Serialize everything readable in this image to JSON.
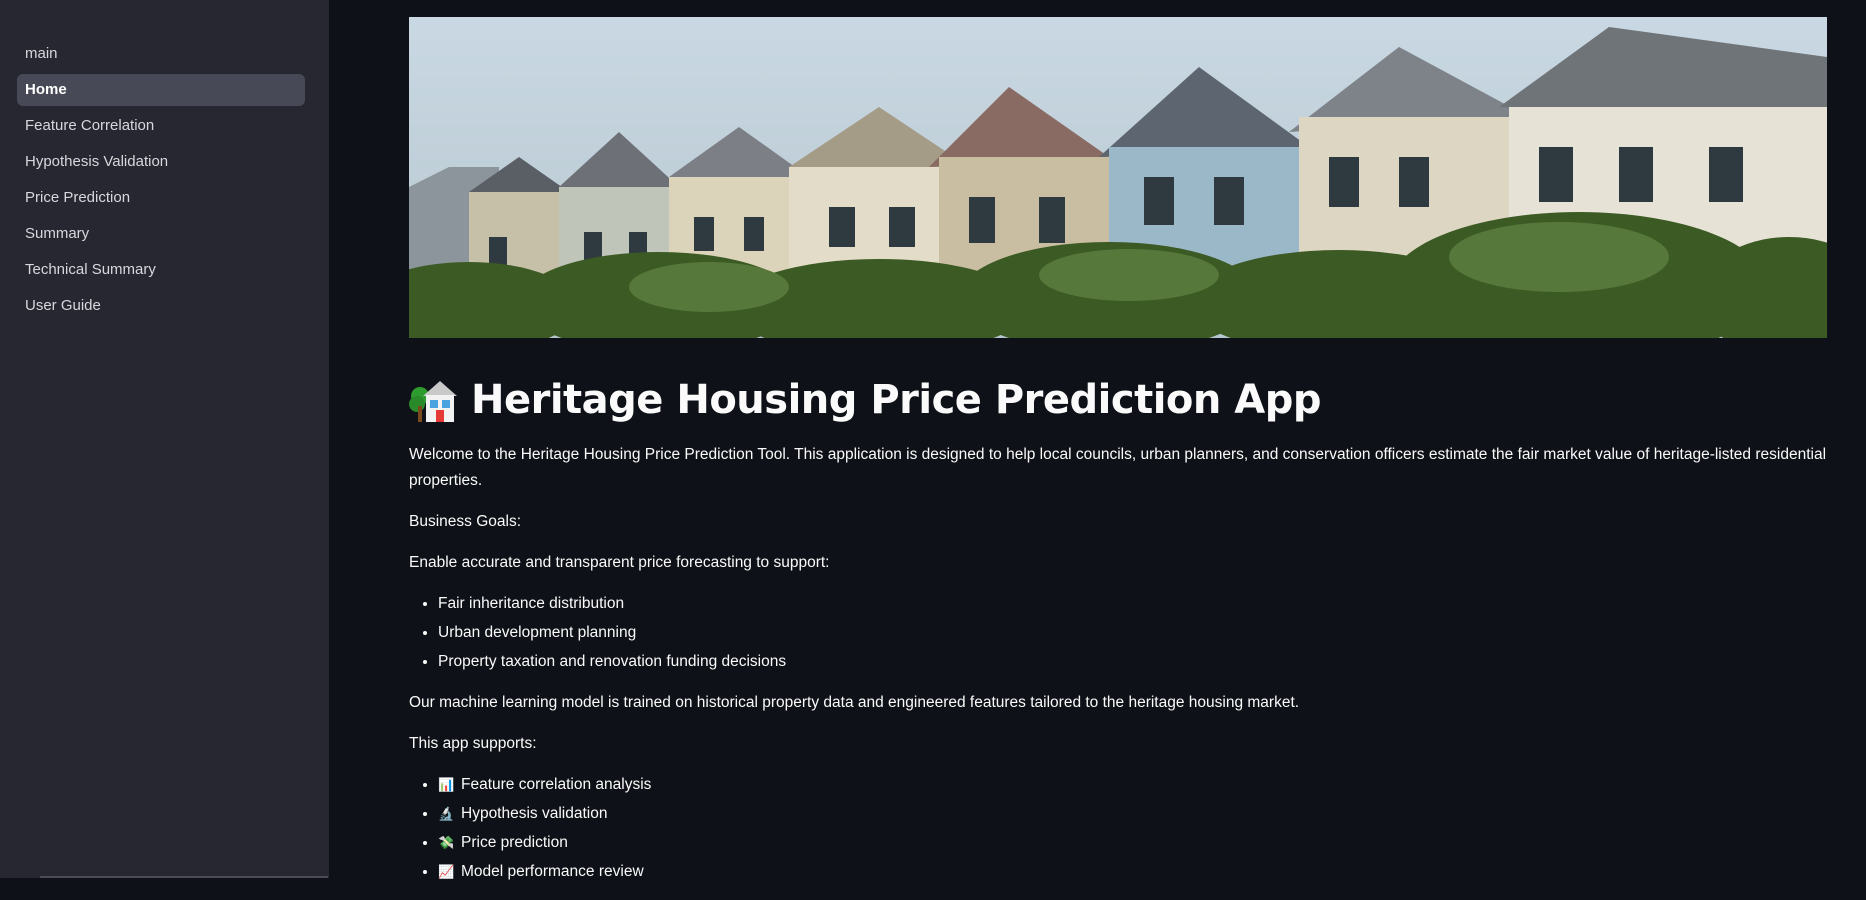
{
  "sidebar": {
    "items": [
      {
        "label": "main",
        "active": false
      },
      {
        "label": "Home",
        "active": true
      },
      {
        "label": "Feature Correlation",
        "active": false
      },
      {
        "label": "Hypothesis Validation",
        "active": false
      },
      {
        "label": "Price Prediction",
        "active": false
      },
      {
        "label": "Summary",
        "active": false
      },
      {
        "label": "Technical Summary",
        "active": false
      },
      {
        "label": "User Guide",
        "active": false
      }
    ]
  },
  "main": {
    "title": "Heritage Housing Price Prediction App",
    "title_icon": "house-with-garden-icon",
    "intro": "Welcome to the Heritage Housing Price Prediction Tool. This application is designed to help local councils, urban planners, and conservation officers estimate the fair market value of heritage-listed residential properties.",
    "business_goals_heading": "Business Goals:",
    "goals_intro": "Enable accurate and transparent price forecasting to support:",
    "goals": [
      "Fair inheritance distribution",
      "Urban development planning",
      "Property taxation and renovation funding decisions"
    ],
    "model_text": "Our machine learning model is trained on historical property data and engineered features tailored to the heritage housing market.",
    "supports_heading": "This app supports:",
    "supports": [
      {
        "icon": "bar-chart-icon",
        "glyph": "📊",
        "label": "Feature correlation analysis"
      },
      {
        "icon": "microscope-icon",
        "glyph": "🔬",
        "label": "Hypothesis validation"
      },
      {
        "icon": "money-with-wings-icon",
        "glyph": "💸",
        "label": "Price prediction"
      },
      {
        "icon": "chart-increasing-icon",
        "glyph": "📈",
        "label": "Model performance review"
      }
    ]
  },
  "colors": {
    "sidebar_bg": "#262730",
    "main_bg": "#0e1117",
    "active_item_bg": "#474956",
    "text": "#fafafa"
  }
}
